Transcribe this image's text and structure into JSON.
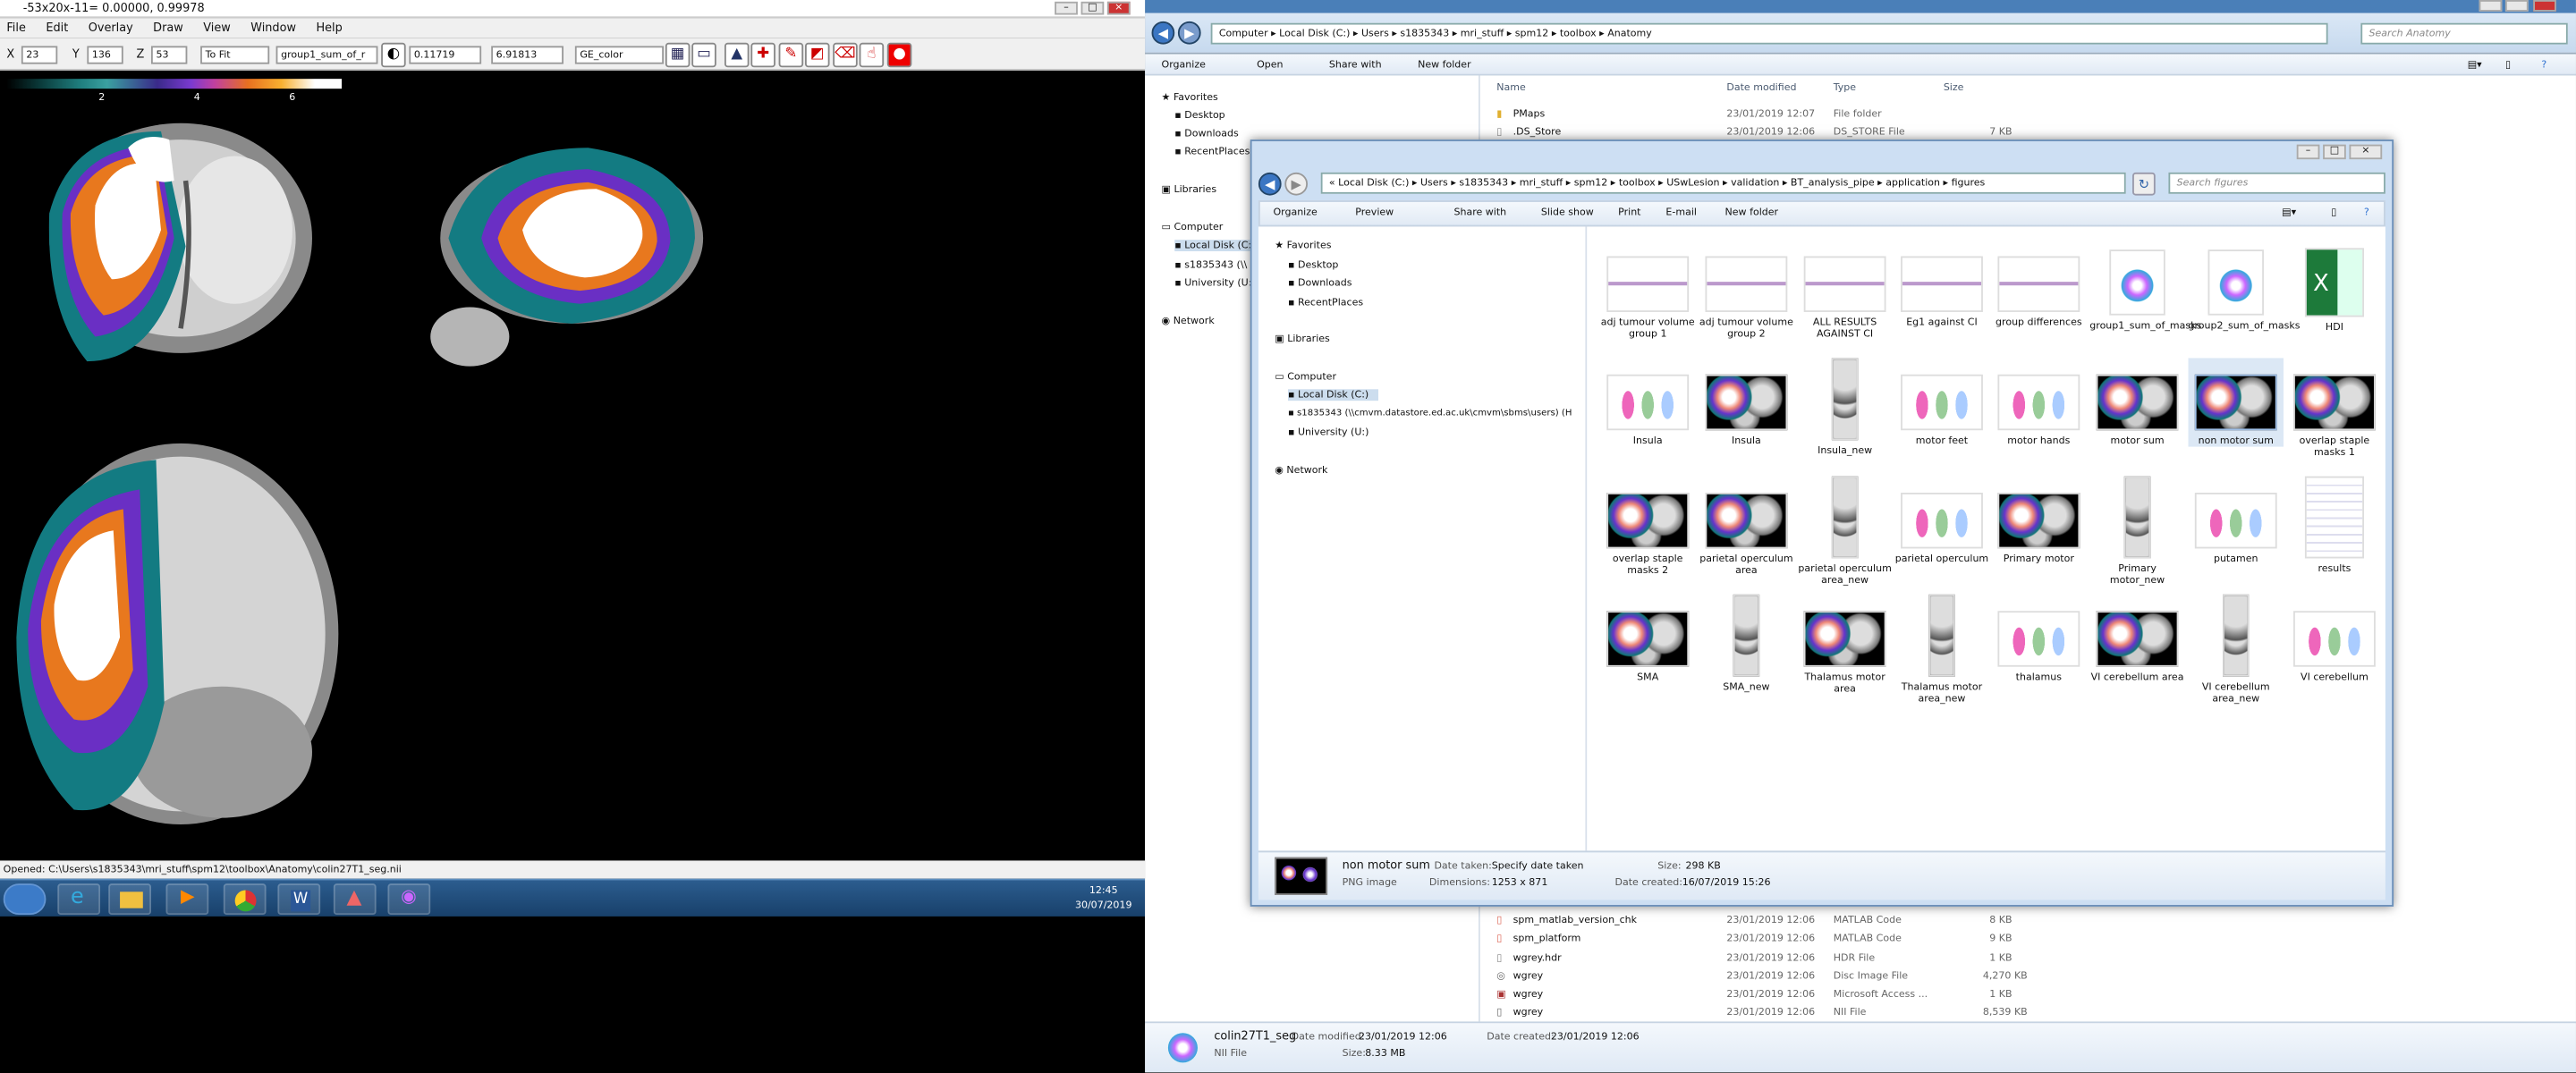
{
  "viewer": {
    "title": "-53x20x-11= 0.00000, 0.99978",
    "menu": [
      "File",
      "Edit",
      "Overlay",
      "Draw",
      "View",
      "Window",
      "Help"
    ],
    "toolbar": {
      "x_label": "X",
      "x_value": "23",
      "y_label": "Y",
      "y_value": "136",
      "z_label": "Z",
      "z_value": "53",
      "zoom": "To Fit",
      "overlay": "group1_sum_of_r",
      "min": "0.11719",
      "max": "6.91813",
      "colormap": "GE_color"
    },
    "colorbar_ticks": [
      "2",
      "4",
      "6"
    ],
    "status": "Opened: C:\\Users\\s1835343\\mri_stuff\\spm12\\toolbox\\Anatomy\\colin27T1_seg.nii"
  },
  "taskbar": {
    "apps": [
      "start-orb",
      "internet-explorer-icon",
      "file-explorer-icon",
      "media-player-icon",
      "chrome-icon",
      "word-icon",
      "matlab-icon",
      "mricron-icon"
    ],
    "time": "12:45",
    "date": "30/07/2019"
  },
  "explorer": {
    "breadcrumb": [
      "Computer",
      "Local Disk (C:)",
      "Users",
      "s1835343",
      "mri_stuff",
      "spm12",
      "toolbox",
      "Anatomy"
    ],
    "search_placeholder": "Search Anatomy",
    "commands": [
      "Organize",
      "Open",
      "Share with",
      "New folder"
    ],
    "nav": {
      "favorites": "Favorites",
      "desktop": "Desktop",
      "downloads": "Downloads",
      "recent": "RecentPlaces",
      "libraries": "Libraries",
      "computer": "Computer",
      "local_disk": "Local Disk (C:)",
      "share": "s1835343 (\\\\",
      "university": "University (U:",
      "network": "Network"
    },
    "columns": {
      "name": "Name",
      "date": "Date modified",
      "type": "Type",
      "size": "Size"
    },
    "top_rows": [
      {
        "name": "PMaps",
        "date": "23/01/2019 12:07",
        "type": "File folder",
        "size": ""
      },
      {
        "name": ".DS_Store",
        "date": "23/01/2019 12:06",
        "type": "DS_STORE File",
        "size": "7 KB"
      }
    ],
    "bottom_rows": [
      {
        "name": "spm_matlab_version_chk",
        "date": "23/01/2019 12:06",
        "type": "MATLAB Code",
        "size": "8 KB"
      },
      {
        "name": "spm_platform",
        "date": "23/01/2019 12:06",
        "type": "MATLAB Code",
        "size": "9 KB"
      },
      {
        "name": "wgrey.hdr",
        "date": "23/01/2019 12:06",
        "type": "HDR File",
        "size": "1 KB"
      },
      {
        "name": "wgrey",
        "date": "23/01/2019 12:06",
        "type": "Disc Image File",
        "size": "4,270 KB"
      },
      {
        "name": "wgrey",
        "date": "23/01/2019 12:06",
        "type": "Microsoft Access ...",
        "size": "1 KB"
      },
      {
        "name": "wgrey",
        "date": "23/01/2019 12:06",
        "type": "NII File",
        "size": "8,539 KB"
      }
    ],
    "detail": {
      "name": "colin27T1_seg",
      "type": "NII File",
      "modified_label": "Date modified:",
      "modified": "23/01/2019 12:06",
      "created_label": "Date created:",
      "created": "23/01/2019 12:06",
      "size_label": "Size:",
      "size": "8.33 MB"
    }
  },
  "figures": {
    "breadcrumb": [
      "Local Disk (C:)",
      "Users",
      "s1835343",
      "mri_stuff",
      "spm12",
      "toolbox",
      "USwLesion",
      "validation",
      "BT_analysis_pipe",
      "application",
      "figures"
    ],
    "search_placeholder": "Search figures",
    "commands": [
      "Organize",
      "Preview",
      "Share with",
      "Slide show",
      "Print",
      "E-mail",
      "New folder"
    ],
    "nav": {
      "favorites": "Favorites",
      "desktop": "Desktop",
      "downloads": "Downloads",
      "recent": "RecentPlaces",
      "libraries": "Libraries",
      "computer": "Computer",
      "local_disk": "Local Disk (C:)",
      "share": "s1835343 (\\\\cmvm.datastore.ed.ac.uk\\cmvm\\sbms\\users) (H",
      "university": "University (U:)",
      "network": "Network"
    },
    "files": [
      {
        "label": "adj tumour volume group 1",
        "kind": "plot"
      },
      {
        "label": "adj tumour volume group 2",
        "kind": "plot"
      },
      {
        "label": "ALL RESULTS AGAINST CI",
        "kind": "plot"
      },
      {
        "label": "Eg1 against CI",
        "kind": "plot"
      },
      {
        "label": "group differences",
        "kind": "plot"
      },
      {
        "label": "group1_sum_of_masks",
        "kind": "nii"
      },
      {
        "label": "group2_sum_of_masks",
        "kind": "nii"
      },
      {
        "label": "HDI",
        "kind": "excel"
      },
      {
        "label": "Insula",
        "kind": "violin"
      },
      {
        "label": "Insula",
        "kind": "brain"
      },
      {
        "label": "Insula_new",
        "kind": "tall"
      },
      {
        "label": "motor feet",
        "kind": "violin"
      },
      {
        "label": "motor hands",
        "kind": "violin"
      },
      {
        "label": "motor sum",
        "kind": "brain"
      },
      {
        "label": "non motor sum",
        "kind": "brain"
      },
      {
        "label": "overlap staple masks 1",
        "kind": "brain"
      },
      {
        "label": "overlap staple masks 2",
        "kind": "brain"
      },
      {
        "label": "parietal operculum area",
        "kind": "brain"
      },
      {
        "label": "parietal operculum area_new",
        "kind": "tall"
      },
      {
        "label": "parietal operculum",
        "kind": "violin"
      },
      {
        "label": "Primary motor",
        "kind": "brain"
      },
      {
        "label": "Primary motor_new",
        "kind": "tall"
      },
      {
        "label": "putamen",
        "kind": "violin"
      },
      {
        "label": "results",
        "kind": "doc"
      },
      {
        "label": "SMA",
        "kind": "brain"
      },
      {
        "label": "SMA_new",
        "kind": "tall"
      },
      {
        "label": "Thalamus motor area",
        "kind": "brain"
      },
      {
        "label": "Thalamus motor area_new",
        "kind": "tall"
      },
      {
        "label": "thalamus",
        "kind": "violin"
      },
      {
        "label": "VI cerebellum area",
        "kind": "brain"
      },
      {
        "label": "VI cerebellum area_new",
        "kind": "tall"
      },
      {
        "label": "VI cerebellum",
        "kind": "violin"
      }
    ],
    "selected_index": 14,
    "status": {
      "name": "non motor sum",
      "type": "PNG image",
      "date_taken_label": "Date taken:",
      "date_taken": "Specify date taken",
      "dimensions_label": "Dimensions:",
      "dimensions": "1253 x 871",
      "size_label": "Size:",
      "size": "298 KB",
      "created_label": "Date created:",
      "created": "16/07/2019 15:26"
    }
  }
}
